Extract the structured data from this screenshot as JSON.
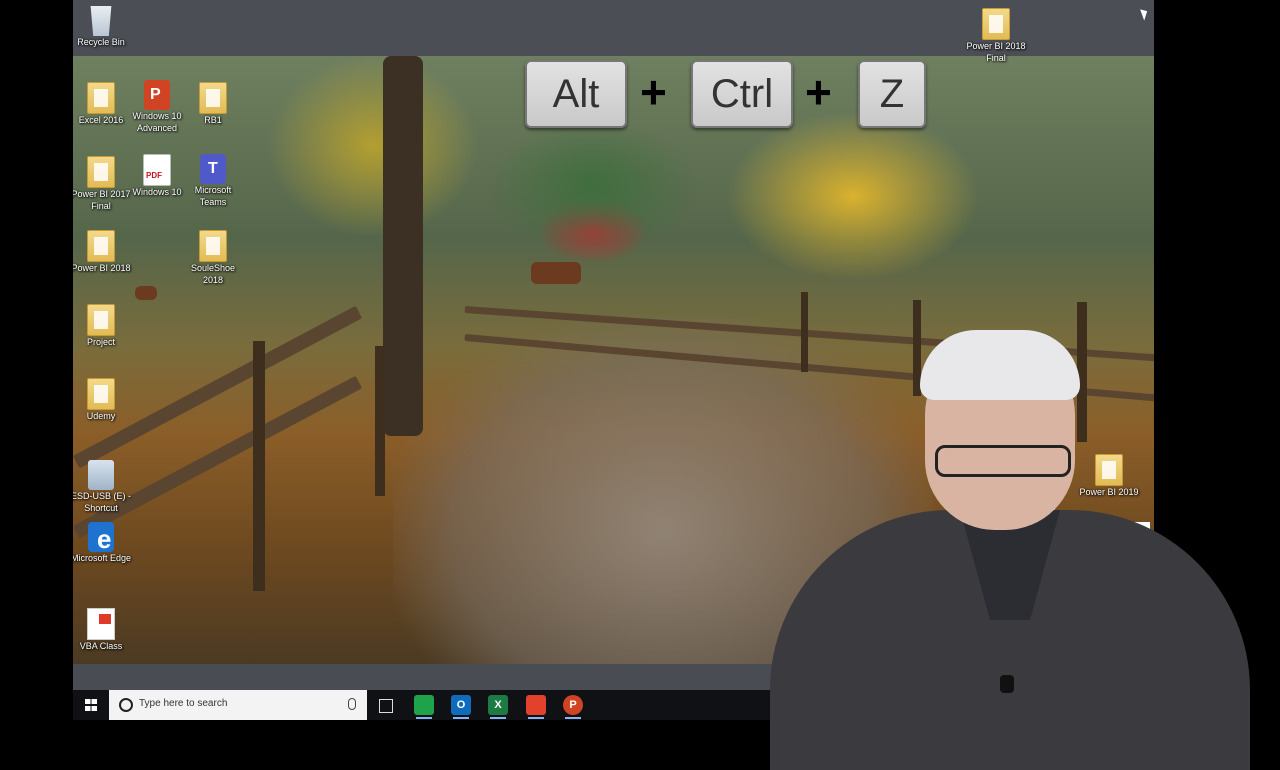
{
  "desktop": {
    "icons": [
      {
        "label": "Recycle Bin"
      },
      {
        "label": "Power BI 2018 Final"
      },
      {
        "label": "Excel 2016"
      },
      {
        "label": "Windows 10 Advanced"
      },
      {
        "label": "RB1"
      },
      {
        "label": "Power BI 2017 Final"
      },
      {
        "label": "Windows 10"
      },
      {
        "label": "Microsoft Teams"
      },
      {
        "label": "Power BI 2018"
      },
      {
        "label": "SouleShoe 2018"
      },
      {
        "label": "Project"
      },
      {
        "label": "Udemy"
      },
      {
        "label": "ESD-USB (E) - Shortcut"
      },
      {
        "label": "Microsoft Edge"
      },
      {
        "label": "VBA Class"
      },
      {
        "label": "Power BI 2019"
      }
    ]
  },
  "keyboard_overlay": {
    "keys": [
      "Alt",
      "Ctrl",
      "Z"
    ],
    "separator": "+"
  },
  "presenter_overlay": {
    "close_symbol": "×"
  },
  "taskbar": {
    "search_placeholder": "Type here to search",
    "apps": [
      {
        "name": "Camtasia",
        "glyph": "",
        "color": "#1fa34a"
      },
      {
        "name": "Outlook",
        "glyph": "O",
        "color": "#0f6cbd"
      },
      {
        "name": "Excel",
        "glyph": "X",
        "color": "#1d7a43"
      },
      {
        "name": "Camtasia Recorder",
        "glyph": "",
        "color": "#e2412c"
      },
      {
        "name": "PowerPoint",
        "glyph": "P",
        "color": "#d04423"
      }
    ]
  }
}
